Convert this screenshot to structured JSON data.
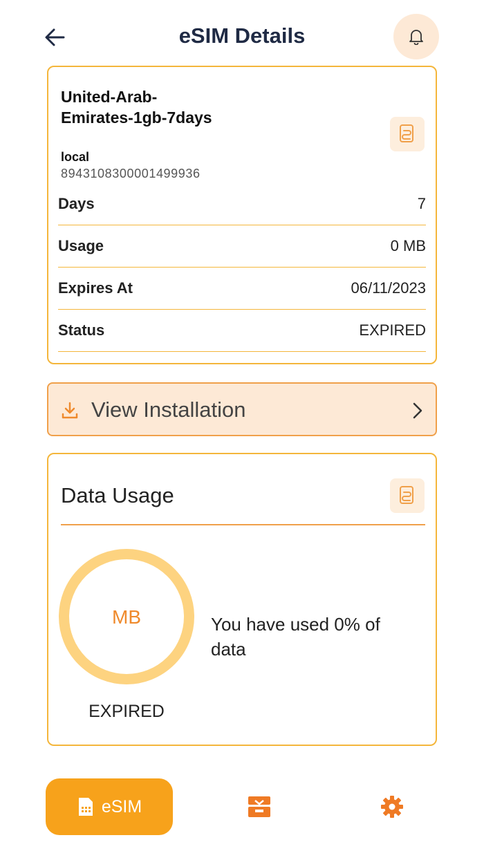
{
  "header": {
    "title": "eSIM Details",
    "back_icon": "arrow-left-icon",
    "bell_icon": "bell-icon"
  },
  "esim": {
    "plan_name": "United-Arab-Emirates-1gb-7days",
    "plan_type": "local",
    "iccid": "8943108300001499936",
    "rows": [
      {
        "label": "Days",
        "value": "7"
      },
      {
        "label": "Usage",
        "value": "0 MB"
      },
      {
        "label": "Expires At",
        "value": "06/11/2023"
      },
      {
        "label": "Status",
        "value": "EXPIRED"
      }
    ]
  },
  "install": {
    "label": "View Installation",
    "icon": "download-icon"
  },
  "usage": {
    "title": "Data Usage",
    "unit": "MB",
    "status": "EXPIRED",
    "summary": "You have used 0% of data",
    "used_fraction": 0
  },
  "nav": {
    "esim_label": "eSIM",
    "items": [
      "esim",
      "store",
      "settings"
    ]
  },
  "colors": {
    "accent": "#f7a21b",
    "accent_light": "#fde9d6",
    "border": "#f4b63b",
    "ring": "#fdd380",
    "orange_text": "#ef8a2c",
    "title": "#1f2a44"
  }
}
